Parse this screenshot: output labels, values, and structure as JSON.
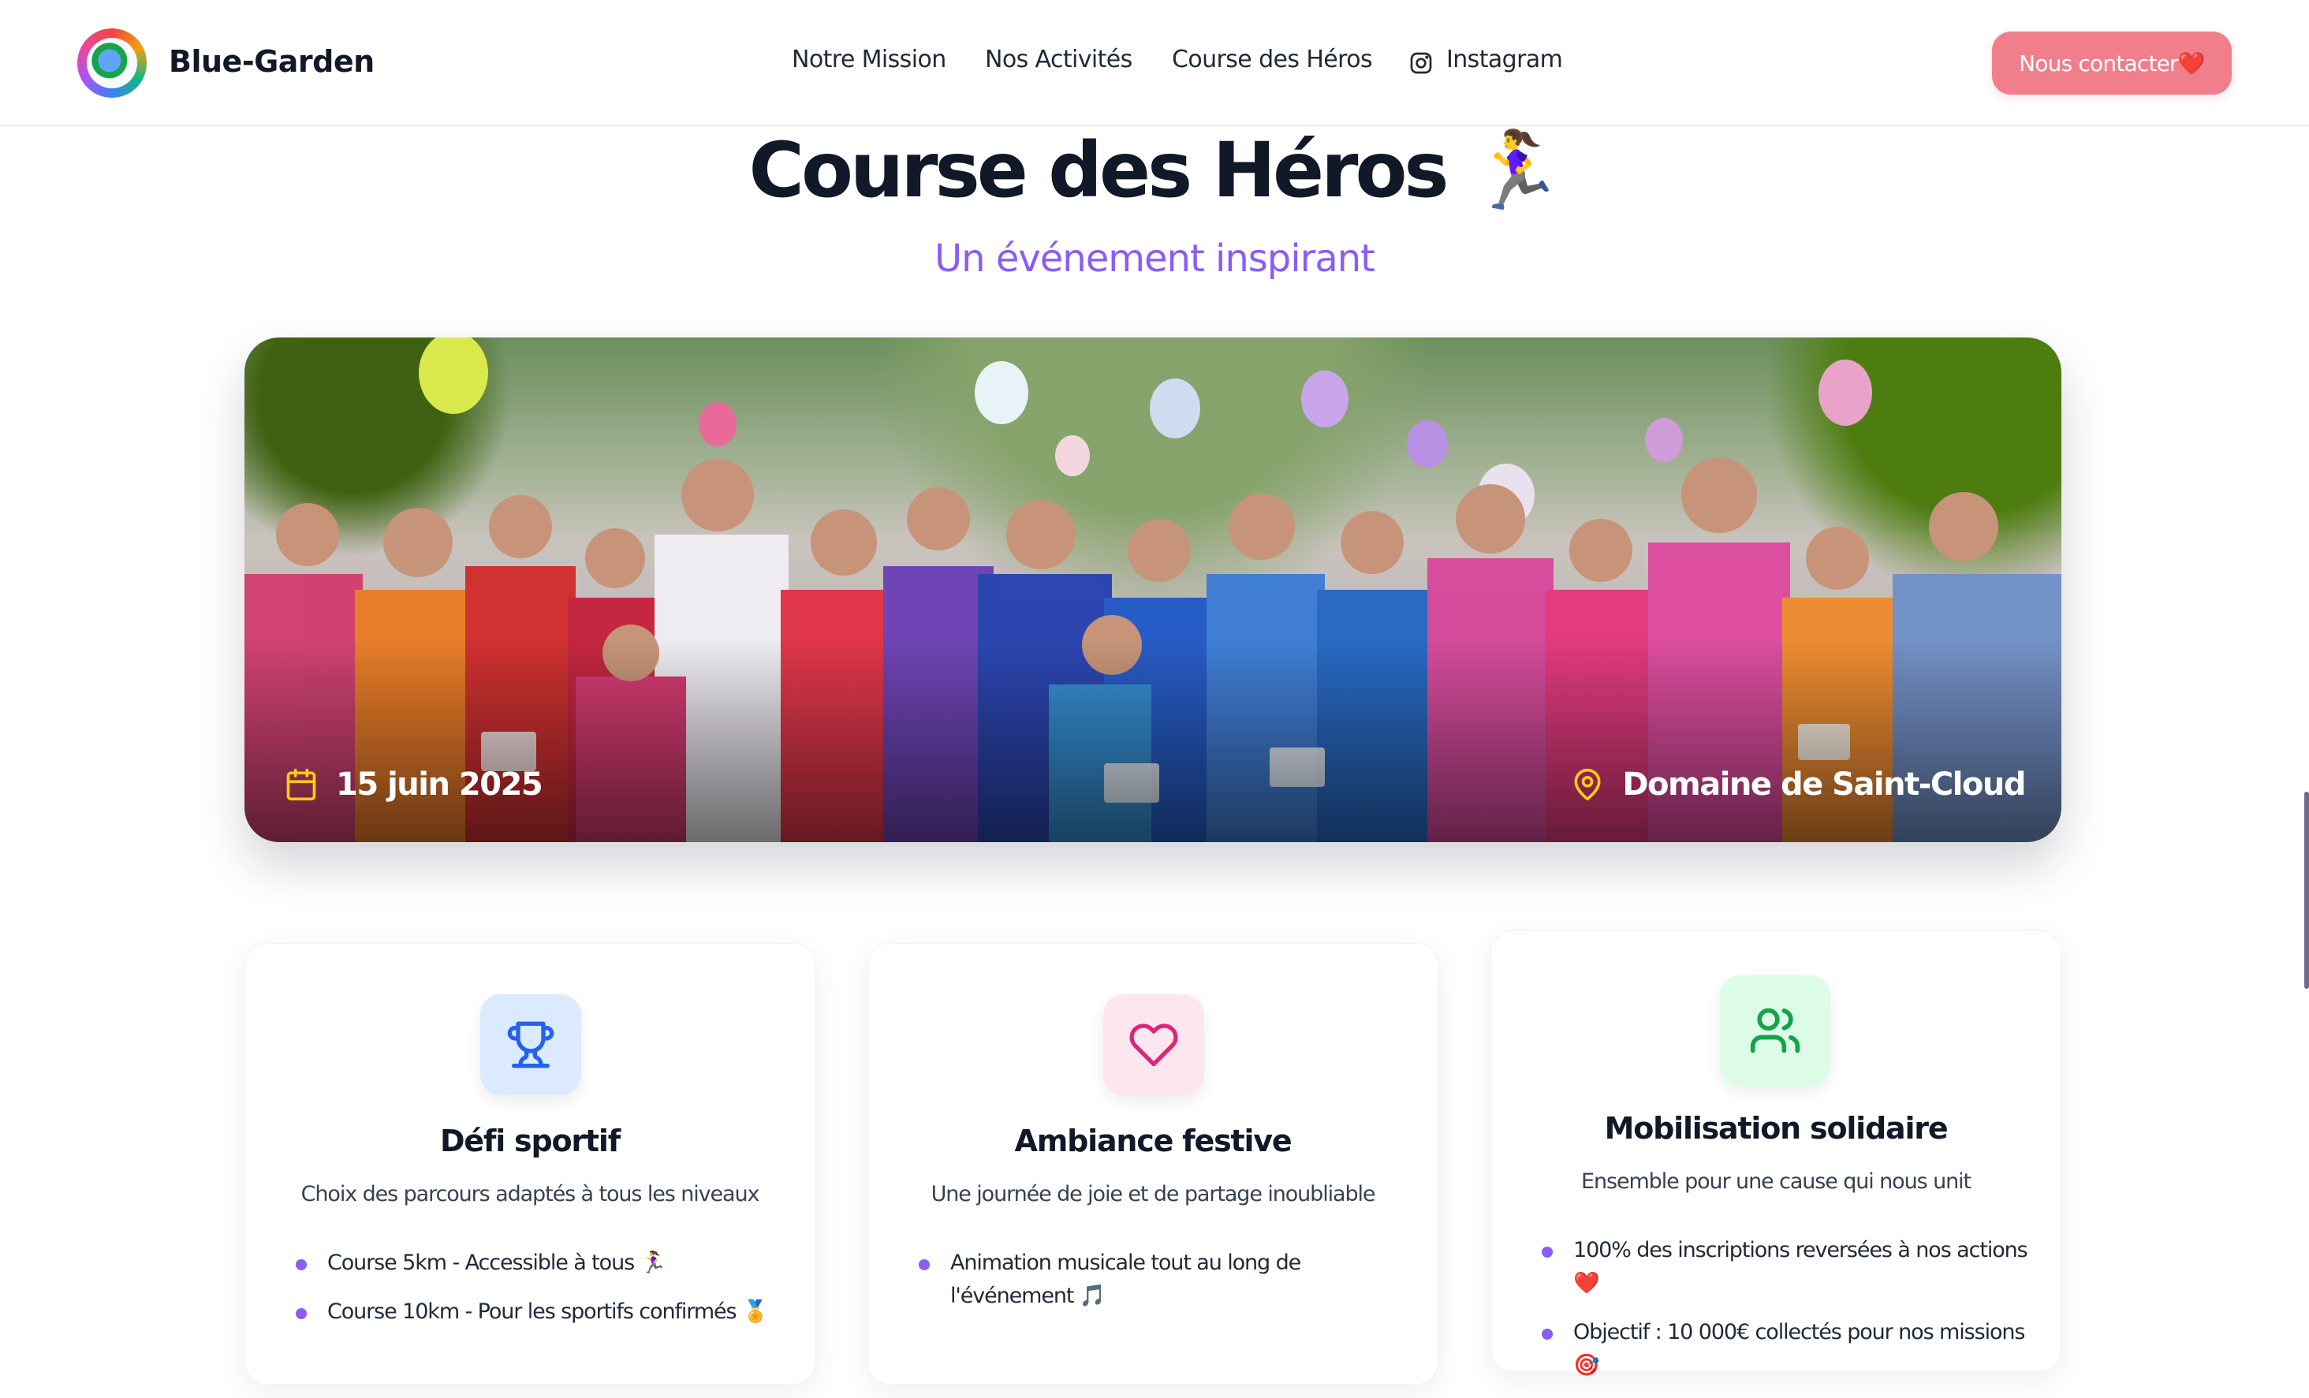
{
  "nav": {
    "brand": "Blue-Garden",
    "links": [
      "Notre Mission",
      "Nos Activités",
      "Course des Héros",
      "Instagram"
    ],
    "contact_label": "Nous contacter❤️"
  },
  "header": {
    "title": "Course des Héros 🏃‍♀️",
    "subtitle": "Un événement inspirant"
  },
  "hero": {
    "date": "15 juin 2025",
    "location": "Domaine de Saint-Cloud",
    "date_icon": "calendar-icon",
    "location_icon": "map-pin-icon"
  },
  "cards": [
    {
      "icon": "trophy-icon",
      "title": "Défi sportif",
      "description": "Choix des parcours adaptés à tous les niveaux",
      "items": [
        "Course 5km - Accessible à tous 🏃‍♀️",
        "Course 10km - Pour les sportifs confirmés 🏅"
      ]
    },
    {
      "icon": "heart-icon",
      "title": "Ambiance festive",
      "description": "Une journée de joie et de partage inoubliable",
      "items": [
        "Animation musicale tout au long de l'événement 🎵"
      ]
    },
    {
      "icon": "users-icon",
      "title": "Mobilisation solidaire",
      "description": "Ensemble pour une cause qui nous unit",
      "items": [
        "100% des inscriptions reversées à nos actions ❤️",
        "Objectif : 10 000€ collectés pour nos missions 🎯"
      ]
    }
  ],
  "colors": {
    "accent_purple": "#8b5cf6",
    "cta_pink": "#f07f8b",
    "trophy_bg": "#dbeafe",
    "heart_bg": "#fce7ef",
    "users_bg": "#dcfce7"
  }
}
